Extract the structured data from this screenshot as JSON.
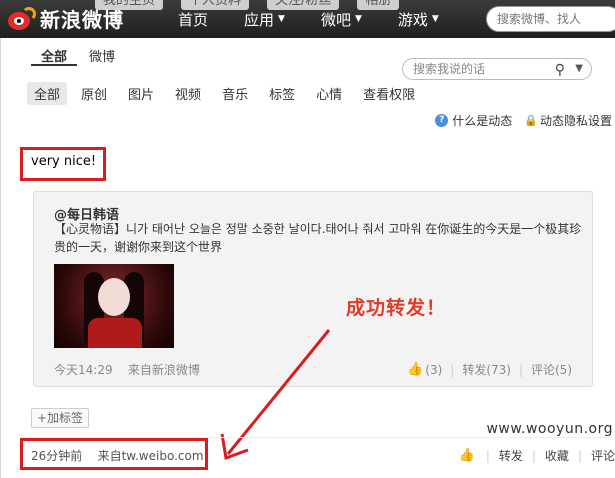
{
  "header": {
    "logo_text": "新浪微博",
    "ghost_tabs": [
      "我的主页",
      "个人资料",
      "关注/粉丝",
      "相册"
    ],
    "nav": [
      {
        "label": "首页",
        "caret": false
      },
      {
        "label": "应用",
        "caret": true
      },
      {
        "label": "微吧",
        "caret": true
      },
      {
        "label": "游戏",
        "caret": true
      }
    ],
    "search_placeholder": "搜索微博、找人"
  },
  "filters": {
    "tabs": [
      "全部",
      "微博"
    ],
    "active": "全部"
  },
  "my_search": {
    "placeholder": "搜索我说的话"
  },
  "subtabs": [
    "全部",
    "原创",
    "图片",
    "视频",
    "音乐",
    "标签",
    "心情",
    "查看权限"
  ],
  "help": {
    "what_is": "什么是动态",
    "privacy": "动态隐私设置"
  },
  "post": {
    "text": "very nice!",
    "repost": {
      "author": "@每日韩语",
      "text": "【心灵物语】니가 태어난 오늘은 정말 소중한 날이다.태어나 줘서 고마워 在你诞生的今天是一个极其珍贵的一天，谢谢你来到这个世界",
      "time": "今天14:29",
      "source": "来自新浪微博",
      "like_count": "(3)",
      "forward": "转发(73)",
      "comment": "评论(5)"
    },
    "annotation": "成功转发！",
    "add_tag": "+加标签",
    "time": "26分钟前",
    "source": "来自tw.weibo.com",
    "actions": {
      "forward": "转发",
      "favorite": "收藏",
      "comment": "评论"
    }
  },
  "watermark": "www.wooyun.org",
  "colors": {
    "annotation_red": "#d91c1c",
    "topbar": "#2a2a2a",
    "link_blue": "#4a7fc1"
  }
}
